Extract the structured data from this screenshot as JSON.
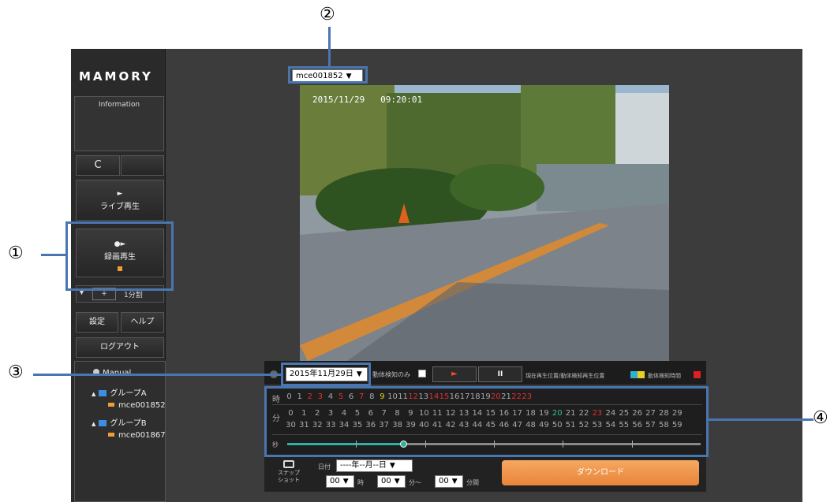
{
  "app": {
    "logo": "MAMORY",
    "information_label": "Information",
    "refresh_label": "C",
    "live_label": "ライブ再生",
    "live_glyph": "►",
    "record_label": "録画再生",
    "record_glyph": "●►",
    "split_plus": "+",
    "split_label": "1分割",
    "settings_label": "設定",
    "help_label": "ヘルプ",
    "logout_label": "ログアウト"
  },
  "tree": {
    "root": "Manual",
    "groups": [
      {
        "name": "グループA",
        "camera": "mce001852"
      },
      {
        "name": "グループB",
        "camera": "mce001867"
      }
    ]
  },
  "camera_select": {
    "value": "mce001852"
  },
  "video": {
    "timestamp": "2015/11/29   09:20:01"
  },
  "controls": {
    "date_value": "2015年11月29日",
    "motion_only_label": "動体検知のみ",
    "play_glyph": "►",
    "pause_glyph": "II",
    "legend_text": "現在再生位置/動体検知再生位置",
    "legend_text2": "動体検知時間"
  },
  "timeline": {
    "hour_label": "時",
    "minute_label": "分",
    "second_label": "秒",
    "hours": [
      "0",
      "1",
      "2",
      "3",
      "4",
      "5",
      "6",
      "7",
      "8",
      "9",
      "10",
      "11",
      "12",
      "13",
      "14",
      "15",
      "16",
      "17",
      "18",
      "19",
      "20",
      "21",
      "22",
      "23"
    ],
    "hour_colors": {
      "2": "#e03030",
      "3": "#e03030",
      "5": "#e03030",
      "7": "#e03030",
      "9": "#e8d020",
      "12": "#e03030",
      "14": "#e03030",
      "15": "#e03030",
      "20": "#e03030",
      "22": "#e03030",
      "23": "#e03030"
    },
    "minutes_row1": [
      "0",
      "1",
      "2",
      "3",
      "4",
      "5",
      "6",
      "7",
      "8",
      "9",
      "10",
      "11",
      "12",
      "13",
      "14",
      "15",
      "16",
      "17",
      "18",
      "19",
      "20",
      "21",
      "22",
      "23",
      "24",
      "25",
      "26",
      "27",
      "28",
      "29"
    ],
    "minutes_row2": [
      "30",
      "31",
      "32",
      "33",
      "34",
      "35",
      "36",
      "37",
      "38",
      "39",
      "40",
      "41",
      "42",
      "43",
      "44",
      "45",
      "46",
      "47",
      "48",
      "49",
      "50",
      "51",
      "52",
      "53",
      "54",
      "55",
      "56",
      "57",
      "58",
      "59"
    ],
    "minute_colors": {
      "20": "#30c0a0",
      "23": "#e03030"
    },
    "seconds_progress": 0.28
  },
  "download": {
    "snapshot_label1": "スナップ",
    "snapshot_label2": "ショット",
    "date_label": "日付",
    "date_placeholder": "----年--月--日",
    "hour_value": "00",
    "hour_unit": "時",
    "min_value": "00",
    "min_unit": "分～",
    "dur_value": "00",
    "dur_unit": "分間",
    "download_label": "ダウンロード"
  },
  "annotations": [
    "①",
    "②",
    "③",
    "④"
  ],
  "colors": {
    "accent_orange": "#f0a030",
    "annot_blue": "#4a76b0",
    "teal": "#30b0a0"
  }
}
